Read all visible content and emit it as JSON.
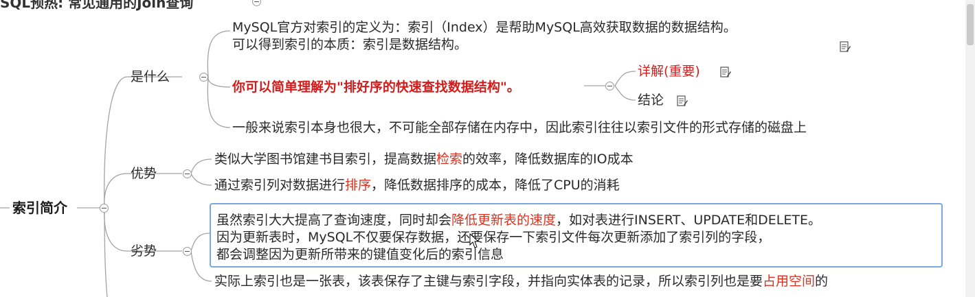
{
  "top_title": "SQL预热: 常见通用的Join查询",
  "root": {
    "label": "索引简介"
  },
  "branches": {
    "what": {
      "label": "是什么",
      "line1": "MySQL官方对索引的定义为：索引（Index）是帮助MySQL高效获取数据的数据结构。",
      "line2": "可以得到索引的本质：索引是数据结构。",
      "key_point": "你可以简单理解为\"排好序的快速查找数据结构\"。",
      "detail_label": "详解(重要)",
      "conclusion_label": "结论",
      "storage_note": "一般来说索引本身也很大，不可能全部存储在内存中，因此索引往往以索引文件的形式存储的磁盘上"
    },
    "advantages": {
      "label": "优势",
      "item1": {
        "before": "类似大学图书馆建书目索引，提高数据",
        "highlight": "检索",
        "after": "的效率，降低数据库的IO成本"
      },
      "item2": {
        "before": "通过索引列对数据进行",
        "highlight": "排序",
        "after": "，降低数据排序的成本，降低了CPU的消耗"
      }
    },
    "disadvantages": {
      "label": "劣势",
      "item1_line1": {
        "before": "虽然索引大大提高了查询速度，同时却会",
        "highlight": "降低更新表的速度",
        "after": "，如对表进行INSERT、UPDATE和DELETE。"
      },
      "item1_line2": "因为更新表时，MySQL不仅要保存数据，还要保存一下索引文件每次更新添加了索引列的字段，",
      "item1_line3": "都会调整因为更新所带来的键值变化后的索引信息",
      "item2": {
        "before": "实际上索引也是一张表，该表保存了主键与索引字段，并指向实体表的记录，所以索引列也是要",
        "highlight": "占用空间",
        "after": "的"
      }
    }
  },
  "colors": {
    "connector": "#9a9a9a",
    "highlight": "#e0301e",
    "selection": "#7aa7e0",
    "emphasis": "#d31b1b"
  },
  "icons": [
    "note-icon",
    "toggle-collapse-icon",
    "cursor-icon"
  ]
}
